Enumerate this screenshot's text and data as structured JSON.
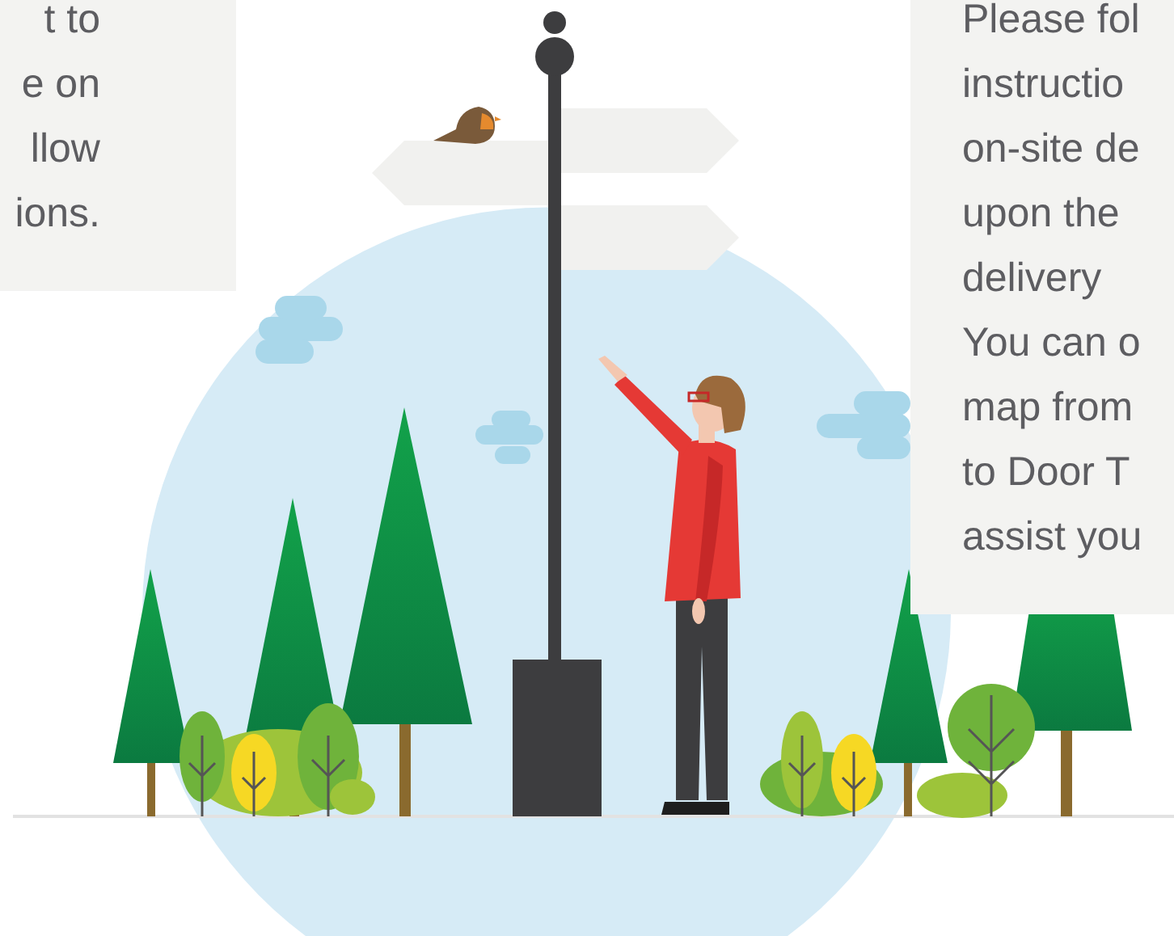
{
  "left_card": {
    "lines": [
      "t to",
      "e on",
      "llow",
      "ions."
    ]
  },
  "right_card": {
    "lines": [
      "Please fol",
      "instructio",
      "on-site de",
      "upon the",
      "delivery",
      "You can o",
      "map from",
      "to Door T",
      "assist you"
    ]
  }
}
